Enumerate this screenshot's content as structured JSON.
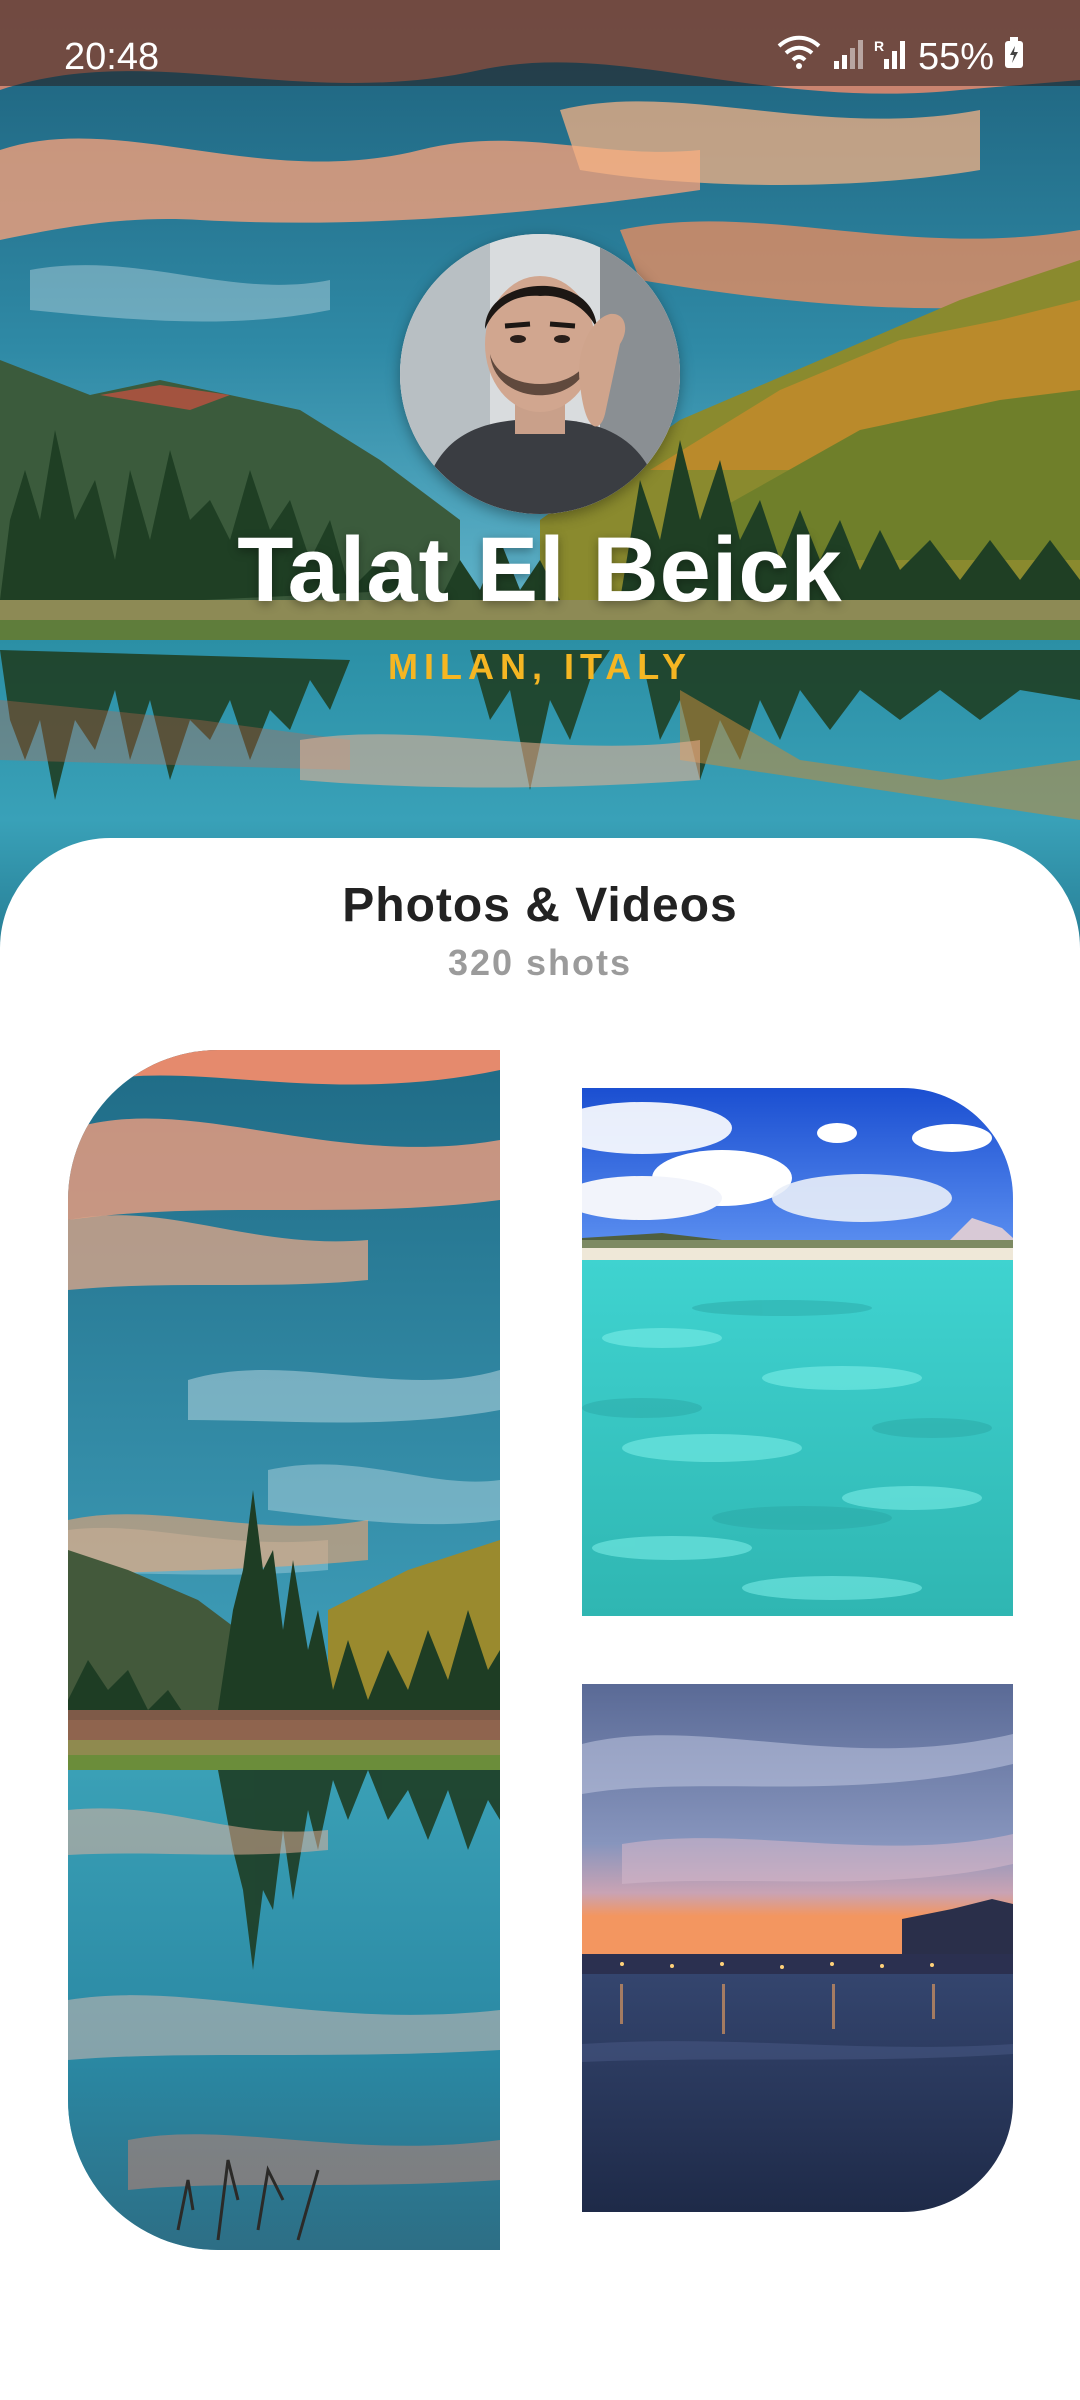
{
  "status_bar": {
    "time": "20:48",
    "battery": "55%",
    "icons": [
      "wifi-icon",
      "signal-icon",
      "signal-icon",
      "battery-icon"
    ]
  },
  "profile": {
    "name": "Talat El Beick",
    "location": "MILAN, ITALY"
  },
  "gallery": {
    "title": "Photos & Videos",
    "count": "320 shots",
    "tiles": [
      "mountain-lake-photo",
      "tropical-beach-photo",
      "harbor-sunset-photo"
    ]
  },
  "colors": {
    "accent": "#f5b623",
    "title": "#222222",
    "muted": "#9b9b9b"
  }
}
